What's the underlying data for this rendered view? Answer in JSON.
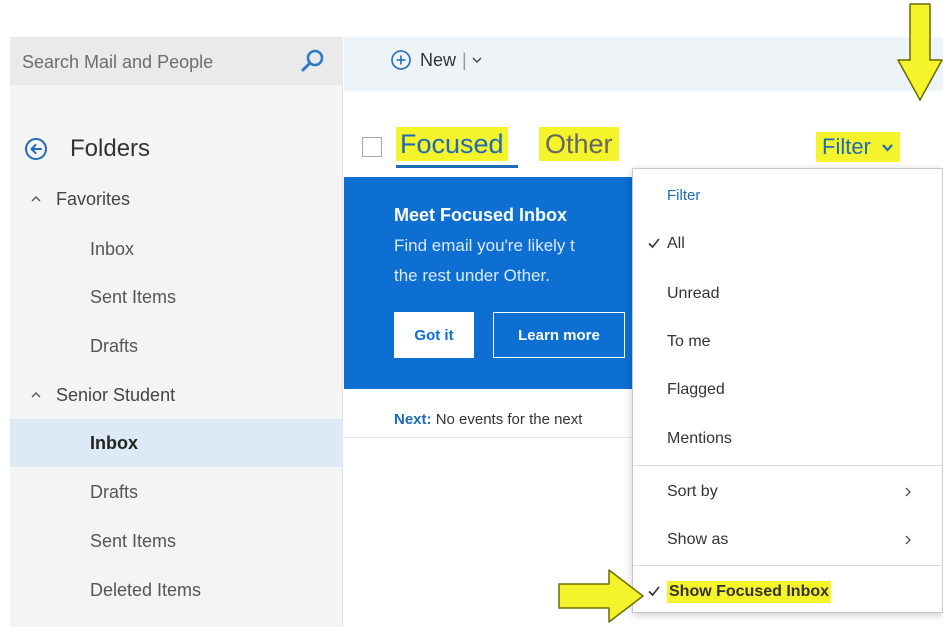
{
  "search": {
    "placeholder": "Search Mail and People"
  },
  "toolbar": {
    "new_label": "New",
    "separator": "|"
  },
  "sidebar": {
    "title": "Folders",
    "groups": [
      {
        "label": "Favorites",
        "items": [
          "Inbox",
          "Sent Items",
          "Drafts"
        ]
      },
      {
        "label": "Senior Student",
        "items": [
          "Inbox",
          "Drafts",
          "Sent Items",
          "Deleted Items"
        ]
      }
    ],
    "selected": "Senior Student / Inbox"
  },
  "main": {
    "tabs": {
      "focused": "Focused",
      "other": "Other"
    },
    "filter_label": "Filter",
    "banner": {
      "title": "Meet Focused Inbox",
      "text_line1": "Find email you're likely t",
      "text_line2": "the rest under Other.",
      "got_it": "Got it",
      "learn_more": "Learn more"
    },
    "next": {
      "label": "Next:",
      "text": "No events for the next"
    }
  },
  "dropdown": {
    "header": "Filter",
    "items": [
      "All",
      "Unread",
      "To me",
      "Flagged",
      "Mentions"
    ],
    "checked": "All",
    "sort_by": "Sort by",
    "show_as": "Show as",
    "show_focused": "Show Focused Inbox"
  },
  "colors": {
    "accent": "#0c6fd1",
    "link": "#1f6bb8",
    "highlight": "#f5f32a",
    "sidebar_bg": "#f4f4f4",
    "selected_bg": "#dde9f5"
  },
  "icons": [
    "search-icon",
    "back-arrow-icon",
    "chevron-up-icon",
    "plus-circle-icon",
    "chevron-down-icon",
    "checkmark-icon",
    "chevron-right-icon"
  ]
}
